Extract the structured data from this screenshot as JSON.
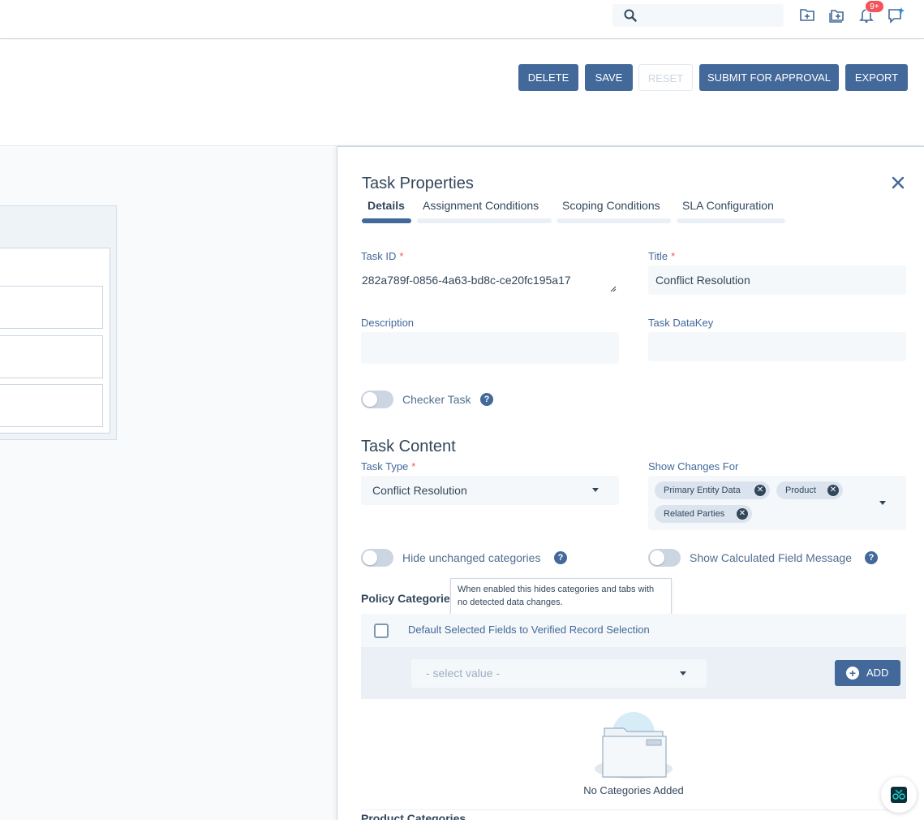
{
  "topbar": {
    "search_placeholder": "",
    "notification_badge": "9+",
    "icons": [
      "search-icon",
      "new-folder-icon",
      "folder-add-icon",
      "bell-icon",
      "ai-chat-icon"
    ]
  },
  "actions": {
    "delete": "DELETE",
    "save": "SAVE",
    "reset": "RESET",
    "submit": "SUBMIT FOR APPROVAL",
    "export": "EXPORT"
  },
  "panel": {
    "title": "Task Properties",
    "tabs": [
      {
        "label": "Details",
        "active": true
      },
      {
        "label": "Assignment Conditions",
        "active": false
      },
      {
        "label": "Scoping Conditions",
        "active": false
      },
      {
        "label": "SLA Configuration",
        "active": false
      }
    ],
    "fields": {
      "task_id_label": "Task ID",
      "task_id_value": "282a789f-0856-4a63-bd8c-ce20fc195a17",
      "title_label": "Title",
      "title_value": "Conflict Resolution",
      "description_label": "Description",
      "description_value": "",
      "datakey_label": "Task DataKey",
      "datakey_value": "",
      "required_mark": "*"
    },
    "checker_task": {
      "label": "Checker Task",
      "enabled": false
    },
    "task_content": {
      "title": "Task Content",
      "task_type_label": "Task Type",
      "task_type_value": "Conflict Resolution",
      "show_changes_label": "Show Changes For",
      "show_changes_chips": [
        "Primary Entity Data",
        "Product",
        "Related Parties"
      ]
    },
    "toggles": {
      "hide_unchanged_label": "Hide unchanged categories",
      "hide_unchanged_enabled": false,
      "show_calc_label": "Show Calculated Field Message",
      "show_calc_enabled": false
    },
    "tooltip": "When enabled this hides categories and tabs with no detected data changes.",
    "policy": {
      "label": "Policy Categories",
      "header_checkbox_label": "Default Selected Fields to Verified Record Selection",
      "select_placeholder": "- select value -",
      "add_label": "ADD",
      "empty_text": "No Categories Added"
    },
    "product_label": "Product Categories",
    "help_glyph": "?",
    "close_glyph": "✕"
  },
  "colors": {
    "primary": "#42699a",
    "required": "#f2545b",
    "field_bg": "#f5f8fa",
    "chip_bg": "#dbe4ee"
  }
}
